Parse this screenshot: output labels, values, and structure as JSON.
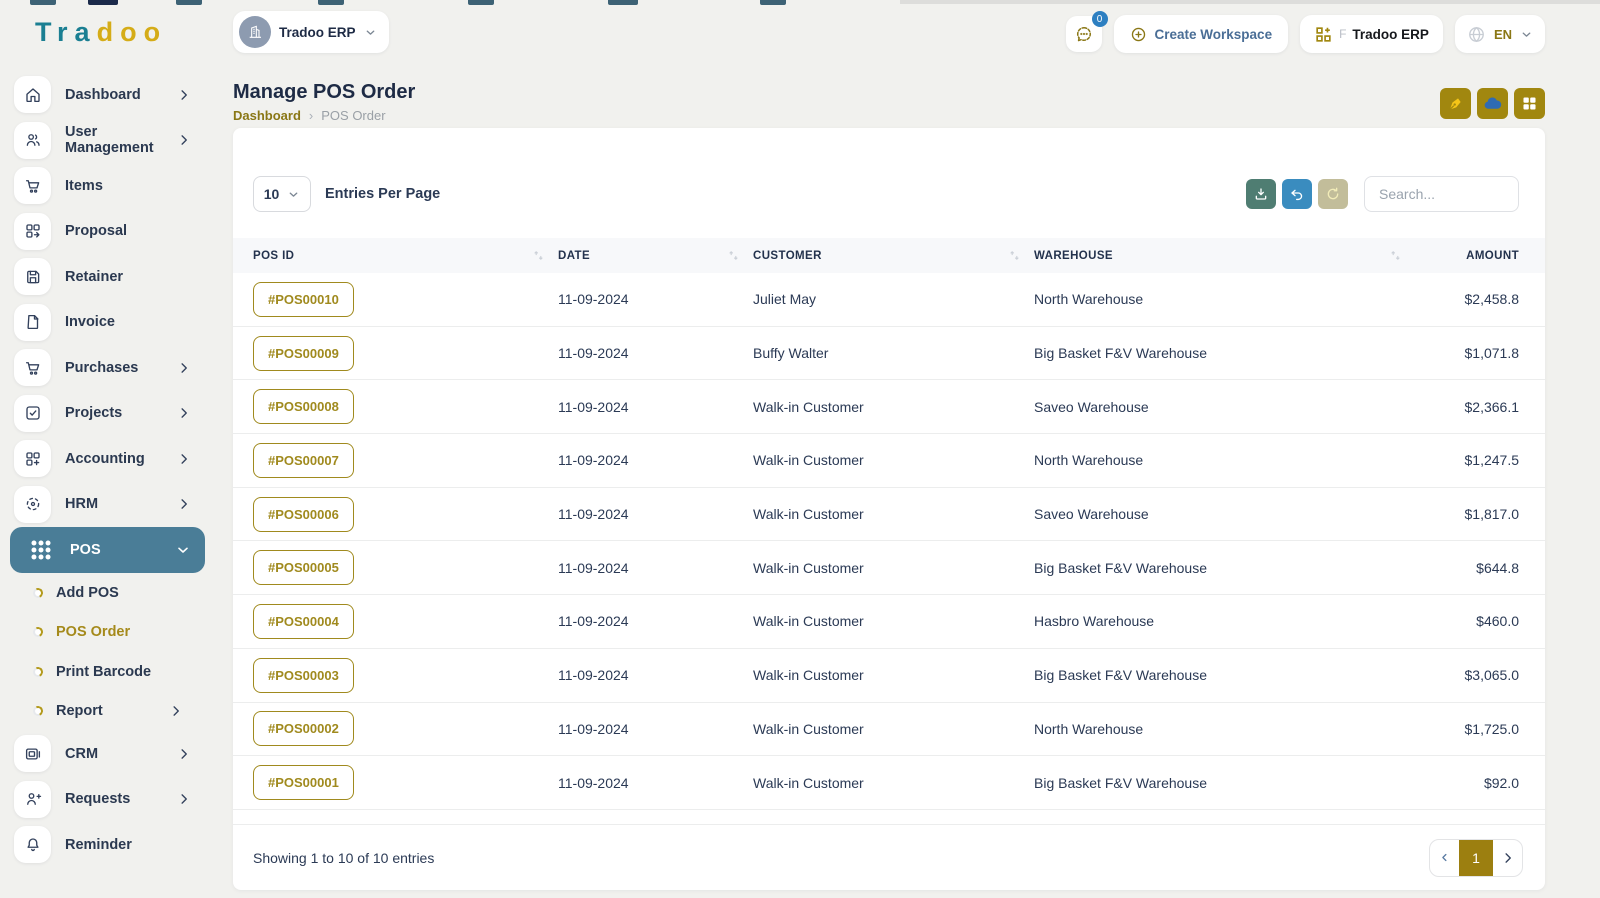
{
  "colors": {
    "teal_active": "#4a7d97",
    "gold": "#a1870f",
    "gold_text": "#a08a1e",
    "navy": "#25324b",
    "blue_accent": "#3a8cbf",
    "badge_blue": "#2d7fc1"
  },
  "topbar": {
    "logo_letters": [
      {
        "ch": "T",
        "color": "#1b7f92"
      },
      {
        "ch": "r",
        "color": "#1b7f92"
      },
      {
        "ch": "a",
        "color": "#1b7f92"
      },
      {
        "ch": "d",
        "color": "#d5ac17"
      },
      {
        "ch": "o",
        "color": "#d5ac17"
      },
      {
        "ch": "o",
        "color": "#d5ac17"
      }
    ],
    "workspace": {
      "label": "Tradoo ERP"
    },
    "chat_badge": "0",
    "create_workspace_label": "Create Workspace",
    "app_button": {
      "prefix": "F",
      "label": "Tradoo ERP"
    },
    "language": {
      "code": "EN"
    }
  },
  "sidebar": {
    "items": [
      {
        "label": "Dashboard",
        "icon": "home",
        "chevron": "right"
      },
      {
        "label": "User Management",
        "icon": "users",
        "chevron": "right"
      },
      {
        "label": "Items",
        "icon": "cart"
      },
      {
        "label": "Proposal",
        "icon": "proposal"
      },
      {
        "label": "Retainer",
        "icon": "retainer"
      },
      {
        "label": "Invoice",
        "icon": "invoice"
      },
      {
        "label": "Purchases",
        "icon": "cart",
        "chevron": "right"
      },
      {
        "label": "Projects",
        "icon": "check-square",
        "chevron": "right"
      },
      {
        "label": "Accounting",
        "icon": "accounting",
        "chevron": "right"
      },
      {
        "label": "HRM",
        "icon": "hrm",
        "chevron": "right"
      },
      {
        "label": "POS",
        "icon": "pos-grid",
        "chevron": "down",
        "active": true
      },
      {
        "label": "Add POS",
        "sub": true
      },
      {
        "label": "POS Order",
        "sub": true,
        "active": true
      },
      {
        "label": "Print Barcode",
        "sub": true
      },
      {
        "label": "Report",
        "sub": true,
        "chevron": "right"
      },
      {
        "label": "CRM",
        "icon": "crm",
        "chevron": "right"
      },
      {
        "label": "Requests",
        "icon": "user-plus",
        "chevron": "right"
      },
      {
        "label": "Reminder",
        "icon": "bell"
      }
    ]
  },
  "page": {
    "title": "Manage POS Order",
    "breadcrumb_home": "Dashboard",
    "breadcrumb_current": "POS Order"
  },
  "table": {
    "entries_per_page": "10",
    "entries_label": "Entries Per Page",
    "search_placeholder": "Search...",
    "columns": [
      "POS ID",
      "DATE",
      "CUSTOMER",
      "WAREHOUSE",
      "AMOUNT"
    ],
    "rows": [
      {
        "id": "#POS00010",
        "date": "11-09-2024",
        "customer": "Juliet May",
        "warehouse": "North Warehouse",
        "amount": "$2,458.8"
      },
      {
        "id": "#POS00009",
        "date": "11-09-2024",
        "customer": "Buffy Walter",
        "warehouse": "Big Basket F&V Warehouse",
        "amount": "$1,071.8"
      },
      {
        "id": "#POS00008",
        "date": "11-09-2024",
        "customer": "Walk-in Customer",
        "warehouse": "Saveo Warehouse",
        "amount": "$2,366.1"
      },
      {
        "id": "#POS00007",
        "date": "11-09-2024",
        "customer": "Walk-in Customer",
        "warehouse": "North Warehouse",
        "amount": "$1,247.5"
      },
      {
        "id": "#POS00006",
        "date": "11-09-2024",
        "customer": "Walk-in Customer",
        "warehouse": "Saveo Warehouse",
        "amount": "$1,817.0"
      },
      {
        "id": "#POS00005",
        "date": "11-09-2024",
        "customer": "Walk-in Customer",
        "warehouse": "Big Basket F&V Warehouse",
        "amount": "$644.8"
      },
      {
        "id": "#POS00004",
        "date": "11-09-2024",
        "customer": "Walk-in Customer",
        "warehouse": "Hasbro Warehouse",
        "amount": "$460.0"
      },
      {
        "id": "#POS00003",
        "date": "11-09-2024",
        "customer": "Walk-in Customer",
        "warehouse": "Big Basket F&V Warehouse",
        "amount": "$3,065.0"
      },
      {
        "id": "#POS00002",
        "date": "11-09-2024",
        "customer": "Walk-in Customer",
        "warehouse": "North Warehouse",
        "amount": "$1,725.0"
      },
      {
        "id": "#POS00001",
        "date": "11-09-2024",
        "customer": "Walk-in Customer",
        "warehouse": "Big Basket F&V Warehouse",
        "amount": "$92.0"
      }
    ],
    "footer_text": "Showing 1 to 10 of 10 entries",
    "pagination": {
      "page": "1"
    }
  }
}
